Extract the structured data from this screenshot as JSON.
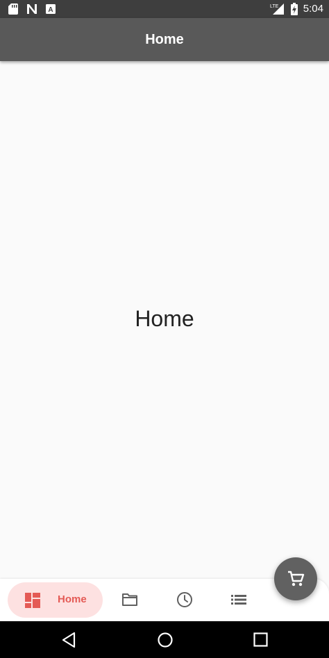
{
  "status_bar": {
    "time": "5:04",
    "network": "LTE",
    "left_icons": [
      "sd-card-icon",
      "n-logo-icon",
      "a-badge-icon"
    ],
    "right_icons": [
      "signal-icon",
      "battery-charging-icon"
    ]
  },
  "app_bar": {
    "title": "Home"
  },
  "main": {
    "center_text": "Home"
  },
  "bottom_nav": {
    "items": [
      {
        "label": "Home",
        "icon": "dashboard-icon",
        "selected": true
      },
      {
        "label": "",
        "icon": "folder-icon",
        "selected": false
      },
      {
        "label": "",
        "icon": "clock-icon",
        "selected": false
      },
      {
        "label": "",
        "icon": "list-icon",
        "selected": false
      }
    ]
  },
  "fab": {
    "icon": "cart-icon"
  },
  "system_nav": {
    "buttons": [
      "back-icon",
      "home-circle-icon",
      "recents-icon"
    ]
  },
  "colors": {
    "app_bar": "#595959",
    "status_bar": "#3e3e3e",
    "accent": "#e45a55",
    "pill_bg": "#fde1e1",
    "fab": "#616161",
    "background": "#fafafa"
  }
}
